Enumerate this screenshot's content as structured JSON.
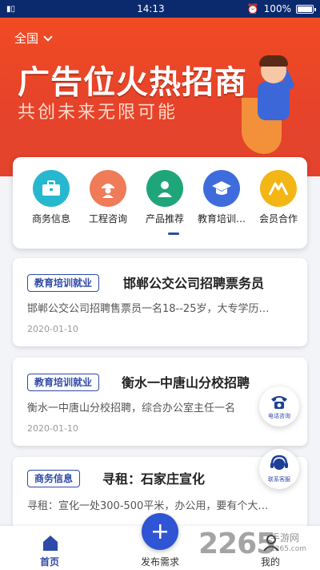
{
  "status_bar": {
    "time": "14:13",
    "battery": "100%"
  },
  "banner": {
    "region": "全国",
    "title": "广告位火热招商",
    "subtitle": "共创未来无限可能"
  },
  "categories": [
    {
      "label": "商务信息",
      "icon": "briefcase-icon",
      "color": "#27b7cf"
    },
    {
      "label": "工程咨询",
      "icon": "engineer-icon",
      "color": "#f07b58"
    },
    {
      "label": "产品推荐",
      "icon": "person-icon",
      "color": "#1fa57a"
    },
    {
      "label": "教育培训…",
      "icon": "graduation-cap-icon",
      "color": "#3f6cdc"
    },
    {
      "label": "会员合作",
      "icon": "member-logo-icon",
      "color": "#f3b615"
    }
  ],
  "listings": [
    {
      "tag": "教育培训就业",
      "title": "邯郸公交公司招聘票务员",
      "desc": "邯郸公交公司招聘售票员一名18--25岁，大专学历…",
      "date": "2020-01-10"
    },
    {
      "tag": "教育培训就业",
      "title": "衡水一中唐山分校招聘",
      "desc": "衡水一中唐山分校招聘，综合办公室主任一名",
      "date": "2020-01-10"
    },
    {
      "tag": "商务信息",
      "title": "寻租：石家庄宣化",
      "desc": "寻租：宣化一处300-500平米，办公用，要有个大…",
      "date": ""
    }
  ],
  "float_buttons": {
    "phone": "电话咨询",
    "service": "联系客服"
  },
  "tabbar": {
    "home": "首页",
    "publish": "发布需求",
    "mine": "我的"
  },
  "watermark": {
    "number": "2265",
    "cn": "手游网",
    "url": "2265.com"
  },
  "colors": {
    "primary": "#2e4aa8",
    "banner": "#e6432a"
  }
}
